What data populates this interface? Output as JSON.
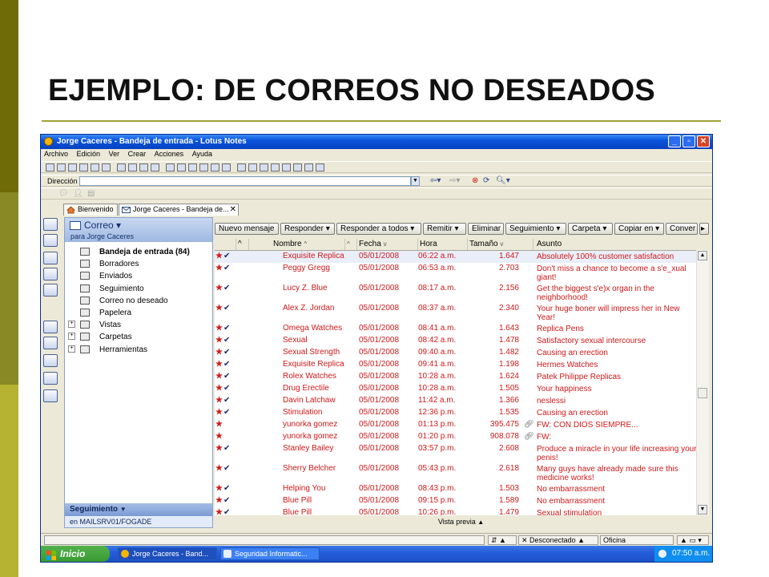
{
  "slide": {
    "title": "EJEMPLO: DE CORREOS NO DESEADOS"
  },
  "window": {
    "title": "Jorge Caceres - Bandeja de entrada - Lotus Notes"
  },
  "menu": [
    "Archivo",
    "Edición",
    "Ver",
    "Crear",
    "Acciones",
    "Ayuda"
  ],
  "address": {
    "label": "Dirección",
    "value": ""
  },
  "tabs": [
    {
      "label": "Bienvenido"
    },
    {
      "label": "Jorge Caceres - Bandeja de..."
    }
  ],
  "nav": {
    "title": "Correo",
    "subtitle": "para Jorge Caceres",
    "items": [
      {
        "label": "Bandeja de entrada (84)",
        "selected": true,
        "icon": "inbox-icon"
      },
      {
        "label": "Borradores",
        "icon": "drafts-icon"
      },
      {
        "label": "Enviados",
        "icon": "sent-icon"
      },
      {
        "label": "Seguimiento",
        "icon": "follow-up-icon"
      },
      {
        "label": "Correo no deseado",
        "icon": "junk-icon"
      },
      {
        "label": "Papelera",
        "icon": "trash-icon"
      },
      {
        "label": "Vistas",
        "expandable": true,
        "icon": "views-icon"
      },
      {
        "label": "Carpetas",
        "expandable": true,
        "icon": "folder-icon"
      },
      {
        "label": "Herramientas",
        "expandable": true,
        "icon": "tools-icon"
      }
    ],
    "section": "Seguimiento",
    "footer": "en MAILSRV01/FOGADE"
  },
  "actions": [
    "Nuevo mensaje",
    "Responder ▾",
    "Responder a todos ▾",
    "Remitir ▾",
    "Eliminar",
    "Seguimiento ▾",
    "Carpeta ▾",
    "Copiar en ▾",
    "Conver"
  ],
  "columns": {
    "sort": "^",
    "name": "Nombre",
    "date": "Fecha",
    "time": "Hora",
    "size": "Tamaño",
    "subject": "Asunto"
  },
  "emails": [
    {
      "name": "Exquisite Replica",
      "date": "05/01/2008",
      "time": "06:22 a.m.",
      "size": "1.647",
      "subject": "Absolutely 100% customer satisfaction",
      "checked": true
    },
    {
      "name": "Peggy Gregg",
      "date": "05/01/2008",
      "time": "06:53 a.m.",
      "size": "2.703",
      "subject": "Don't miss a chance to become a s'e_xual giant!",
      "checked": true
    },
    {
      "name": "Lucy Z. Blue",
      "date": "05/01/2008",
      "time": "08:17 a.m.",
      "size": "2.156",
      "subject": "Get the biggest s'e)x organ in the neighborhood!",
      "checked": true
    },
    {
      "name": "Alex Z. Jordan",
      "date": "05/01/2008",
      "time": "08:37 a.m.",
      "size": "2.340",
      "subject": "Your huge boner will impress her in New Year!",
      "checked": true
    },
    {
      "name": "Omega Watches",
      "date": "05/01/2008",
      "time": "08:41 a.m.",
      "size": "1.643",
      "subject": "Replica Pens",
      "checked": true
    },
    {
      "name": "Sexual",
      "date": "05/01/2008",
      "time": "08:42 a.m.",
      "size": "1.478",
      "subject": "Satisfactory sexual intercourse",
      "checked": true
    },
    {
      "name": "Sexual Strength",
      "date": "05/01/2008",
      "time": "09:40 a.m.",
      "size": "1.482",
      "subject": "Causing an erection",
      "checked": true
    },
    {
      "name": "Exquisite Replica",
      "date": "05/01/2008",
      "time": "09:41 a.m.",
      "size": "1.198",
      "subject": "Hermes Watches",
      "checked": true
    },
    {
      "name": "Rolex Watches",
      "date": "05/01/2008",
      "time": "10:28 a.m.",
      "size": "1.624",
      "subject": "Patek Philippe Replicas",
      "checked": true
    },
    {
      "name": "Drug Erectile",
      "date": "05/01/2008",
      "time": "10:28 a.m.",
      "size": "1.505",
      "subject": "Your happiness",
      "checked": true
    },
    {
      "name": "Davin Latchaw",
      "date": "05/01/2008",
      "time": "11:42 a.m.",
      "size": "1.366",
      "subject": "neslessi",
      "checked": true
    },
    {
      "name": "Stimulation",
      "date": "05/01/2008",
      "time": "12:36 p.m.",
      "size": "1.535",
      "subject": "Causing an erection",
      "checked": true
    },
    {
      "name": "yunorka gomez",
      "date": "05/01/2008",
      "time": "01:13 p.m.",
      "size": "395.475",
      "subject": "FW: CON DIOS SIEMPRE...",
      "checked": false,
      "attachment": true
    },
    {
      "name": "yunorka gomez",
      "date": "05/01/2008",
      "time": "01:20 p.m.",
      "size": "908.078",
      "subject": "FW:",
      "checked": false,
      "attachment": true
    },
    {
      "name": "Stanley Bailey",
      "date": "05/01/2008",
      "time": "03:57 p.m.",
      "size": "2.608",
      "subject": "Produce a miracle in your life increasing your penis!",
      "checked": true
    },
    {
      "name": "Sherry Belcher",
      "date": "05/01/2008",
      "time": "05:43 p.m.",
      "size": "2.618",
      "subject": "Many guys have already made sure this medicine works!",
      "checked": true
    },
    {
      "name": "Helping You",
      "date": "05/01/2008",
      "time": "08:43 p.m.",
      "size": "1.503",
      "subject": "No embarrassment",
      "checked": true
    },
    {
      "name": "Blue Pill",
      "date": "05/01/2008",
      "time": "09:15 p.m.",
      "size": "1.589",
      "subject": "No embarrassment",
      "checked": true
    },
    {
      "name": "Blue Pill",
      "date": "05/01/2008",
      "time": "10:26 p.m.",
      "size": "1.479",
      "subject": "Sexual stimulation",
      "checked": true
    }
  ],
  "preview_label": "Vista previa",
  "status": {
    "connection": "Desconectado",
    "location": "Oficina"
  },
  "taskbar": {
    "start": "Inicio",
    "tasks": [
      "Jorge Caceres - Band...",
      "Seguridad Informatic..."
    ],
    "clock": "07:50 a.m."
  },
  "colors": {
    "deco_dark": "#6f6b07",
    "deco_mid": "#898a26",
    "deco_light": "#b6b232",
    "spam_text": "#d01919",
    "titlebar": "#0a54dc"
  }
}
